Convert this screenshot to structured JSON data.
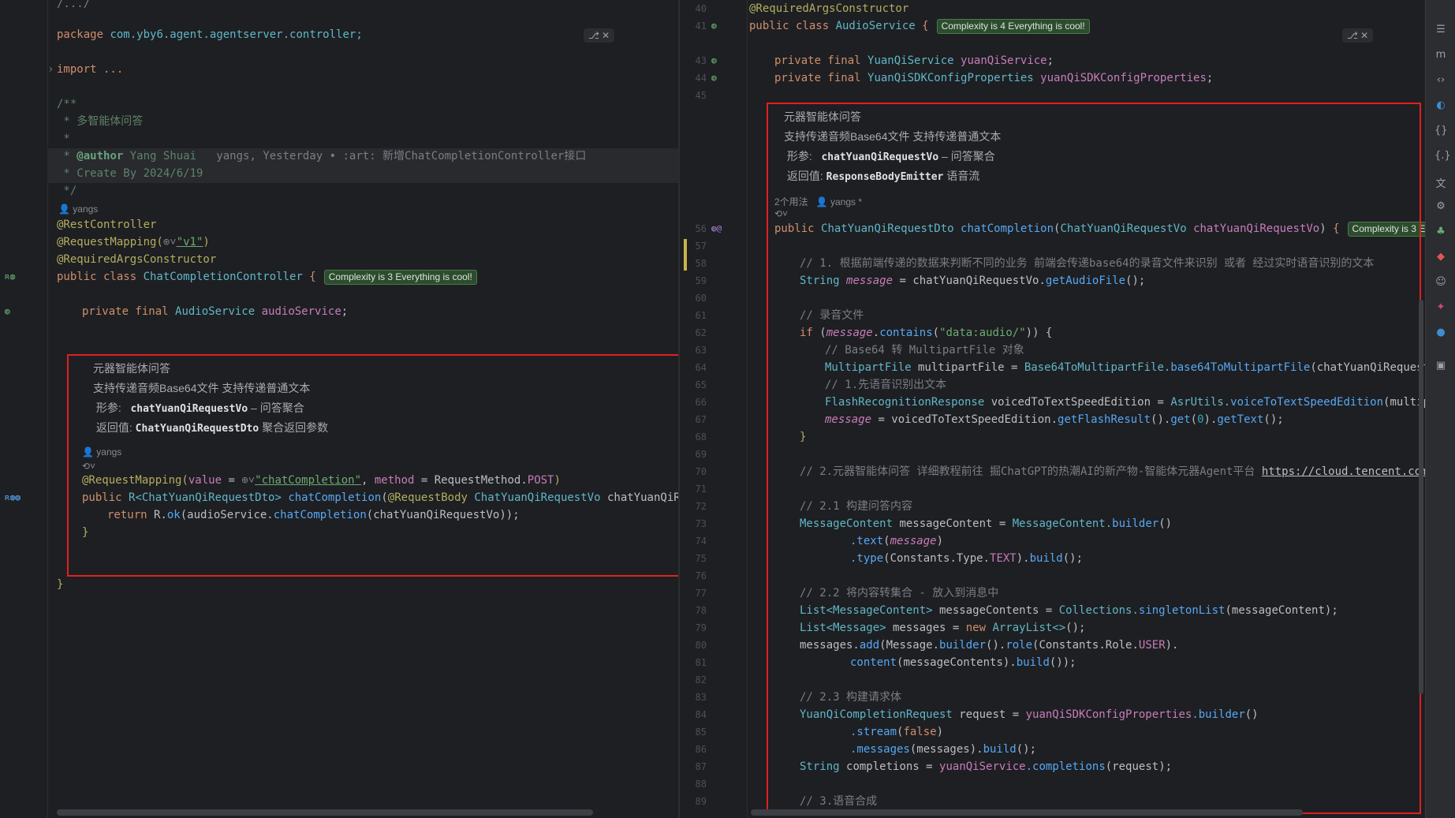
{
  "left": {
    "tab_chip": "⎇ ✕",
    "lines": {
      "top": "/.../",
      "package_kw": "package",
      "package_name": "com.yby6.agent.agentserver.controller;",
      "import": "import ...",
      "doc_open": "/**",
      "doc_title": " * 多智能体问答",
      "doc_star": " *",
      "doc_author_tag": "@author",
      "doc_author": " Yang Shuai   ",
      "doc_blame": "yangs, Yesterday • :art: 新增ChatCompletionController接口",
      "doc_create": " * Create By 2024/6/19",
      "doc_close": " */",
      "author_hint": "yangs",
      "ann_rest": "@RestController",
      "ann_reqmap": "@RequestMapping(",
      "ann_reqmap_val": "\"v1\"",
      "ann_reqargs": "@RequiredArgsConstructor",
      "class_decl_kw": "public class ",
      "class_name": "ChatCompletionController",
      "class_brace": " {",
      "class_badge": "Complexity is 3 Everything is cool!",
      "field_kw": "private final ",
      "field_type": "AudioService",
      "field_name": "audioService",
      "method_ann": "@RequestMapping(",
      "method_ann_value_key": "value",
      "method_ann_value": "\"chatCompletion\"",
      "method_ann_method_key": "method",
      "method_ann_method": "RequestMethod.",
      "method_ann_post": "POST",
      "method_sig_kw": "public ",
      "method_sig_type": "R<ChatYuanQiRequestDto>",
      "method_sig_name": "chatCompletion",
      "method_sig_ann": "@RequestBody",
      "method_sig_ptype": "ChatYuanQiRequestVo",
      "method_sig_pname": "chatYuanQiReque",
      "return_kw": "return ",
      "return_expr_a": "R.",
      "return_expr_ok": "ok",
      "return_expr_b": "(audioService.",
      "return_expr_call": "chatCompletion",
      "return_expr_c": "(chatYuanQiRequestVo));",
      "close_brace": "}",
      "class_close": "}"
    },
    "doc": {
      "title": "元器智能体问答",
      "desc": "支持传递音频Base64文件 支持传递普通文本",
      "param_label": "形参:",
      "param_name": "chatYuanQiRequestVo",
      "param_desc": " – 问答聚合",
      "return_label": "返回值:",
      "return_type": "ChatYuanQiRequestDto",
      "return_desc": " 聚合返回参数",
      "author": "yangs"
    }
  },
  "right": {
    "tab_chip": "⎇ ✕",
    "line_numbers": [
      "40",
      "41",
      "43",
      "44",
      "45",
      "56",
      "57",
      "58",
      "59",
      "60",
      "61",
      "62",
      "63",
      "64",
      "65",
      "66",
      "67",
      "68",
      "69",
      "70",
      "71",
      "72",
      "73",
      "74",
      "75",
      "76",
      "77",
      "78",
      "79",
      "80",
      "81",
      "82",
      "83",
      "84",
      "85",
      "86",
      "87",
      "88",
      "89"
    ],
    "lines": {
      "l40": "@RequiredArgsConstructor",
      "l41_kw": "public class ",
      "l41_cls": "AudioService",
      "l41_brace": " {",
      "l41_badge": "Complexity is 4 Everything is cool!",
      "l43_type": "YuanQiService",
      "l43_name": "yuanQiService",
      "l44_type": "YuanQiSDKConfigProperties",
      "l44_name": "yuanQiSDKConfigProperties",
      "pf": "private final ",
      "semi": ";",
      "usages": "2个用法",
      "author": "yangs *",
      "l56_kw": "public ",
      "l56_type": "ChatYuanQiRequestDto",
      "l56_name": "chatCompletion",
      "l56_ptype": "ChatYuanQiRequestVo",
      "l56_pname": "chatYuanQiRequestVo",
      "l56_badge": "Complexity is 3 Everything",
      "l58": "// 1. 根据前端传递的数据来判断不同的业务 前端会传递base64的录音文件来识别 或者 经过实时语音识别的文本",
      "l59_type": "String ",
      "l59_var": "message",
      "l59_rest": " = chatYuanQiRequestVo.",
      "l59_call": "getAudioFile",
      "l59_end": "();",
      "l61": "// 录音文件",
      "l62_if": "if ",
      "l62_var": "message",
      "l62_call": "contains",
      "l62_str": "\"data:audio/\"",
      "l63": "// Base64 转 MultipartFile 对象",
      "l64_type": "MultipartFile",
      "l64_rest": " multipartFile = ",
      "l64_cls": "Base64ToMultipartFile.",
      "l64_call": "base64ToMultipartFile",
      "l64_end": "(chatYuanQiRequestVo.get",
      "l65": "// 1.先语音识别出文本",
      "l66_type": "FlashRecognitionResponse",
      "l66_rest": " voicedToTextSpeedEdition = ",
      "l66_cls": "AsrUtils.",
      "l66_call": "voiceToTextSpeedEdition",
      "l66_end": "(multipartFil",
      "l67_var": "message",
      "l67_rest": " = voicedToTextSpeedEdition.",
      "l67_call": "getFlashResult",
      "l67_b": "().",
      "l67_get": "get",
      "l67_num": "0",
      "l67_c": ").",
      "l67_text": "getText",
      "l67_end": "();",
      "l68": "}",
      "l70_cmt": "// 2.元器智能体问答 详细教程前往 掘ChatGPT的热潮AI的新产物-智能体元器Agent平台 ",
      "l70_url": "https://cloud.tencent.com/develo",
      "l72": "// 2.1 构建问答内容",
      "l73_type": "MessageContent",
      "l73_rest": " messageContent = ",
      "l73_cls": "MessageContent.",
      "l73_call": "builder",
      "l73_end": "()",
      "l74_call": ".text",
      "l74_var": "message",
      "l75_call": ".type",
      "l75_rest": "(Constants.Type.",
      "l75_const": "TEXT",
      "l75_b": ").",
      "l75_build": "build",
      "l75_end": "();",
      "l77": "// 2.2 将内容转集合 - 放入到消息中",
      "l78_type": "List<MessageContent>",
      "l78_rest": " messageContents = ",
      "l78_cls": "Collections.",
      "l78_call": "singletonList",
      "l78_end": "(messageContent);",
      "l79_type": "List<Message>",
      "l79_rest": " messages = ",
      "l79_new": "new ",
      "l79_cls": "ArrayList<>",
      "l79_end": "();",
      "l80_a": "messages.",
      "l80_add": "add",
      "l80_b": "(Message.",
      "l80_builder": "builder",
      "l80_c": "().",
      "l80_role": "role",
      "l80_d": "(Constants.Role.",
      "l80_user": "USER",
      "l80_e": ").",
      "l81_call": "content",
      "l81_rest": "(messageContents).",
      "l81_build": "build",
      "l81_end": "());",
      "l83": "// 2.3 构建请求体",
      "l84_type": "YuanQiCompletionRequest",
      "l84_rest": " request = ",
      "l84_field": "yuanQiSDKConfigProperties",
      "l84_call": ".builder",
      "l84_end": "()",
      "l85_call": ".stream",
      "l85_kw": "false",
      "l86_call": ".messages",
      "l86_rest": "(messages).",
      "l86_build": "build",
      "l86_end": "();",
      "l87_type": "String ",
      "l87_rest": "completions = ",
      "l87_field": "yuanQiService",
      "l87_call": ".completions",
      "l87_end": "(request);",
      "l89": "// 3.语音合成"
    },
    "doc": {
      "title": "元器智能体问答",
      "desc": "支持传递音频Base64文件 支持传递普通文本",
      "param_label": "形参:",
      "param_name": "chatYuanQiRequestVo",
      "param_desc": " – 问答聚合",
      "return_label": "返回值:",
      "return_type": "ResponseBodyEmitter",
      "return_desc": " 语音流"
    }
  }
}
